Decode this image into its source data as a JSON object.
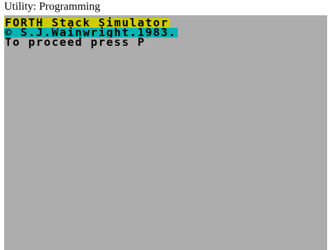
{
  "caption": "Utility: Programming",
  "screen": {
    "background": "#adadad",
    "lines": [
      {
        "text": "FORTH Stack Simulator",
        "background": "#cdcd00",
        "color": "#000000"
      },
      {
        "text": "© S.J.Wainwright.1983.",
        "background": "#00b4b4",
        "color": "#000000"
      },
      {
        "text": "To proceed press P",
        "background": "#adadad",
        "color": "#000000"
      }
    ]
  }
}
